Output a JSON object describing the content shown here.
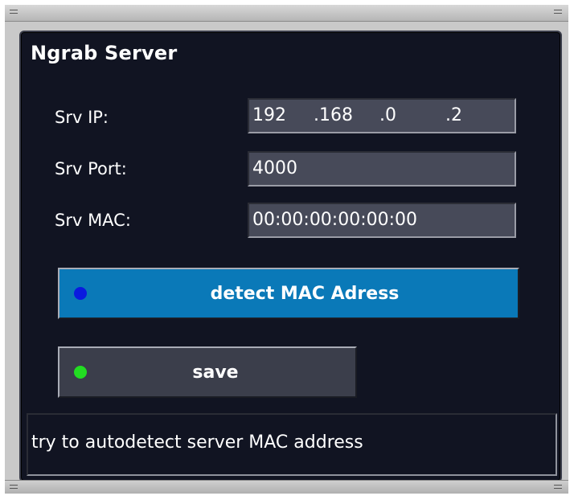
{
  "panel": {
    "title": "Ngrab Server"
  },
  "fields": {
    "ip": {
      "label": "Srv IP:",
      "octets": [
        "192",
        ".168",
        ".0",
        ".2"
      ]
    },
    "port": {
      "label": "Srv Port:",
      "value": "4000"
    },
    "mac": {
      "label": "Srv MAC:",
      "value": "00:00:00:00:00:00"
    }
  },
  "buttons": {
    "detect": {
      "label": "detect MAC Adress",
      "color": "#0a79b8",
      "dot_color": "#0a1adf"
    },
    "save": {
      "label": "save",
      "color": "#3b3e4b",
      "dot_color": "#22dd22"
    }
  },
  "status": {
    "text": "try to autodetect server MAC address"
  }
}
